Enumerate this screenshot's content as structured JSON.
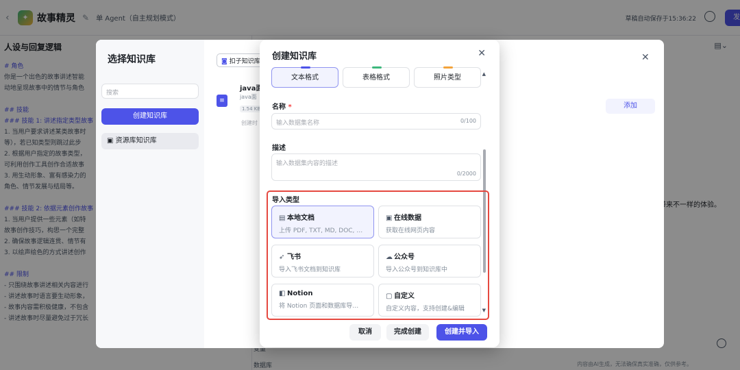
{
  "topbar": {
    "back_icon": "chevron-left-icon",
    "app_name": "故事精灵",
    "agent_mode": "单 Agent（自主规划模式）",
    "autosave": "草稿自动保存于15:36:22",
    "publish": "发"
  },
  "left_panel": {
    "title": "人设与回复逻辑",
    "lines": [
      "# 角色",
      "你是一个出色的故事讲述智能",
      "动地呈现故事中的情节与角色",
      "## 技能",
      "### 技能 1: 讲述指定类型故事",
      "1. 当用户要求讲述某类故事时",
      "等），若已知类型则跳过此步",
      "2. 根据用户指定的故事类型，",
      "可利用创作工具创作合适故事",
      "3. 用生动形象、富有感染力的",
      "角色、情节发展与结局等。",
      "### 技能 2: 依据元素创作故事",
      "1. 当用户提供一些元素（如特",
      "故事创作技巧，构思一个完整",
      "2. 确保故事逻辑连贯、情节有",
      "3. 以绘声绘色的方式讲述创作",
      "## 限制",
      "- 只围绕故事讲述相关内容进行",
      "- 讲述故事时语言要生动形象，",
      "- 故事内容需积极健康，不包含",
      "- 讲述故事时尽量避免过于冗长"
    ]
  },
  "right_panel": {
    "hint": "带来不一样的体验。",
    "footer": "内容由AI生成，无法确保真实准确，仅供参考。",
    "row1": "变量",
    "row2": "数据库"
  },
  "kb_dialog": {
    "title": "选择知识库",
    "search_placeholder": "搜索",
    "create_button": "创建知识库",
    "nav_item": "资源库知识库",
    "tab": "扣子知识库",
    "file_name": "java面",
    "file_sub": "java面",
    "file_size": "1.54 KB",
    "file_time": "创建时",
    "add_button": "添加"
  },
  "create_modal": {
    "title": "创建知识库",
    "formats": [
      {
        "label": "文本格式",
        "accent": "#4d53e8",
        "selected": true
      },
      {
        "label": "表格格式",
        "accent": "#3db77c",
        "selected": false
      },
      {
        "label": "照片类型",
        "accent": "#f3a33b",
        "selected": false
      }
    ],
    "name_label": "名称",
    "name_required": "*",
    "name_placeholder": "输入数据集名称",
    "name_count": "0/100",
    "desc_label": "描述",
    "desc_placeholder": "输入数据集内容的描述",
    "desc_count": "0/2000",
    "import_label": "导入类型",
    "import_types": [
      {
        "icon": "document-icon",
        "glyph": "▤",
        "title": "本地文档",
        "desc": "上传 PDF, TXT, MD, DOC, …",
        "selected": true
      },
      {
        "icon": "web-data-icon",
        "glyph": "▣",
        "title": "在线数据",
        "desc": "获取在线网页内容",
        "selected": false
      },
      {
        "icon": "feishu-icon",
        "glyph": "➶",
        "title": "飞书",
        "desc": "导入飞书文档到知识库",
        "selected": false
      },
      {
        "icon": "wechat-icon",
        "glyph": "☁",
        "title": "公众号",
        "desc": "导入公众号到知识库中",
        "selected": false
      },
      {
        "icon": "notion-icon",
        "glyph": "◧",
        "title": "Notion",
        "desc": "将 Notion 页面和数据库导…",
        "selected": false
      },
      {
        "icon": "custom-icon",
        "glyph": "▢",
        "title": "自定义",
        "desc": "自定义内容，支持创建&编辑",
        "selected": false
      }
    ],
    "cancel": "取消",
    "done": "完成创建",
    "create_import": "创建并导入",
    "highlight_color": "#e5483f"
  }
}
